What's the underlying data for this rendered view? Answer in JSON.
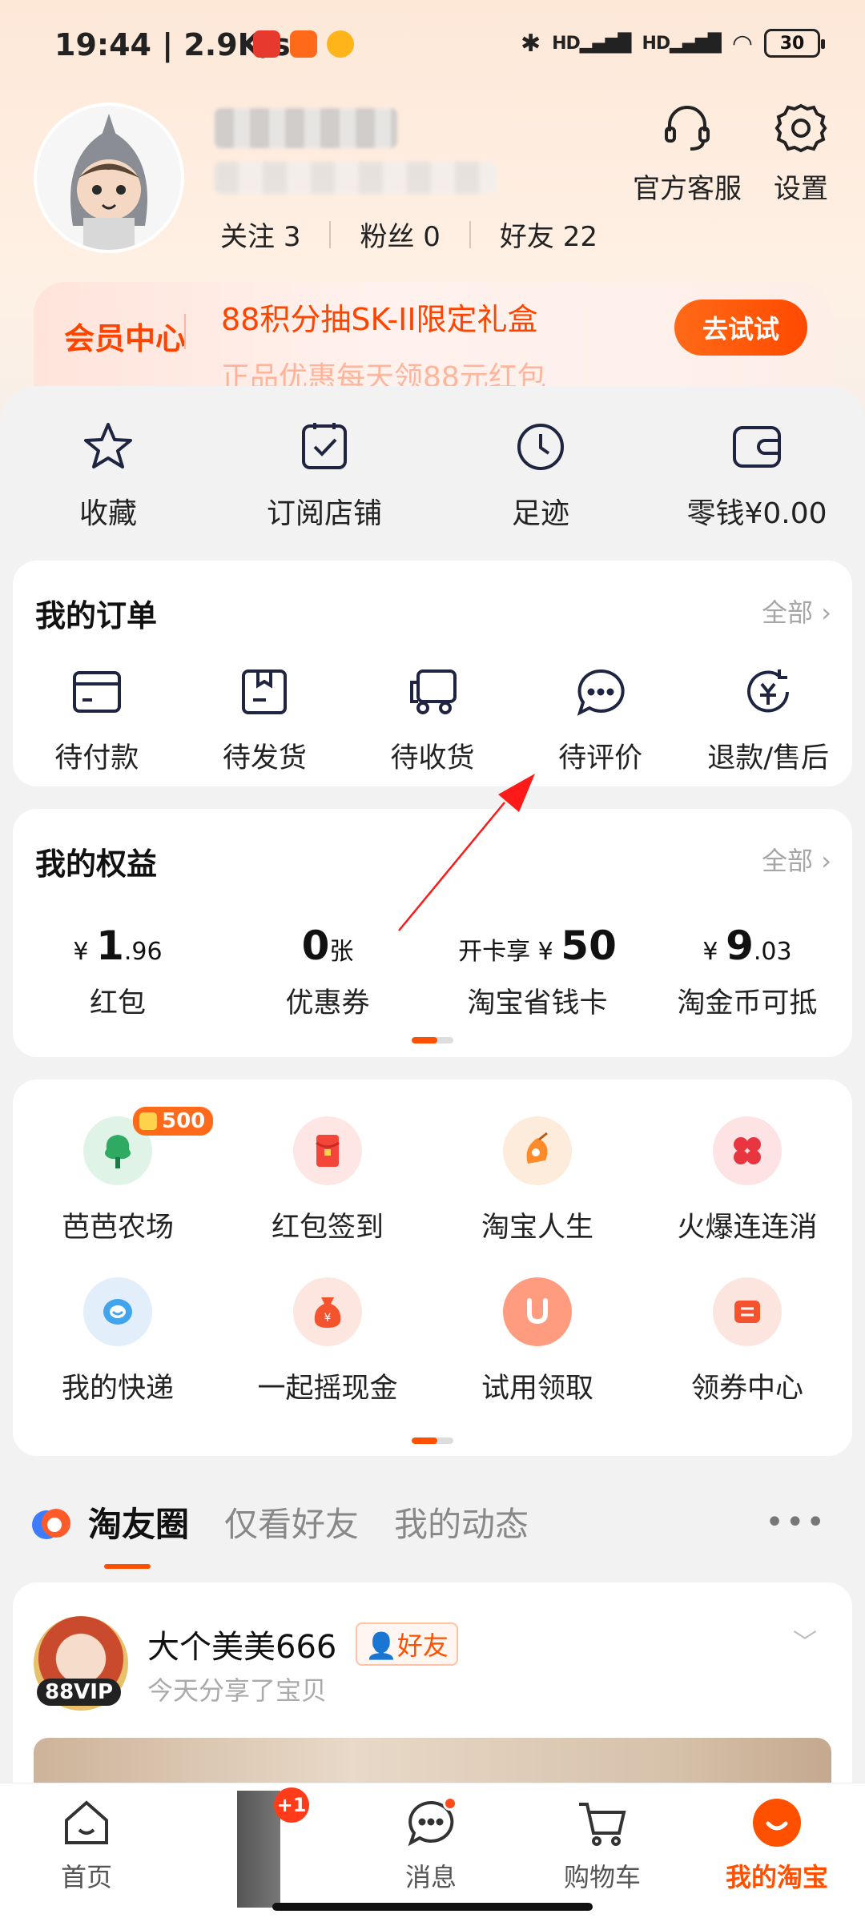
{
  "status_bar": {
    "time": "19:44",
    "speed": "2.9K/s",
    "battery": "30"
  },
  "profile": {
    "follow_label": "关注",
    "follow_count": "3",
    "fans_label": "粉丝",
    "fans_count": "0",
    "friends_label": "好友",
    "friends_count": "22",
    "service_label": "官方客服",
    "settings_label": "设置"
  },
  "member": {
    "title": "会员中心",
    "promo": "88积分抽SK-II限定礼盒",
    "promo2": "正品优惠每天领88元红包",
    "button": "去试试"
  },
  "quick": [
    {
      "label": "收藏",
      "icon": "star-icon"
    },
    {
      "label": "订阅店铺",
      "icon": "subscribe-icon"
    },
    {
      "label": "足迹",
      "icon": "clock-icon"
    },
    {
      "label": "零钱¥0.00",
      "icon": "wallet-icon"
    }
  ],
  "orders": {
    "title": "我的订单",
    "more": "全部",
    "items": [
      {
        "label": "待付款",
        "icon": "card-icon"
      },
      {
        "label": "待发货",
        "icon": "box-icon"
      },
      {
        "label": "待收货",
        "icon": "truck-icon"
      },
      {
        "label": "待评价",
        "icon": "chat-icon"
      },
      {
        "label": "退款/售后",
        "icon": "refund-icon"
      }
    ]
  },
  "equity": {
    "title": "我的权益",
    "more": "全部",
    "items": [
      {
        "prefix": "¥",
        "big": "1",
        "small": ".96",
        "label": "红包"
      },
      {
        "prefix": "",
        "big": "0",
        "small": "张",
        "label": "优惠券"
      },
      {
        "prefix": "开卡享 ¥",
        "big": "50",
        "small": "",
        "label": "淘宝省钱卡"
      },
      {
        "prefix": "¥",
        "big": "9",
        "small": ".03",
        "label": "淘金币可抵"
      }
    ]
  },
  "tools": {
    "badge": "500",
    "items": [
      {
        "label": "芭芭农场",
        "icon": "farm-icon",
        "color": "#dff4e7"
      },
      {
        "label": "红包签到",
        "icon": "redpacket-icon",
        "color": "#fde6e4"
      },
      {
        "label": "淘宝人生",
        "icon": "life-icon",
        "color": "#fdebdc"
      },
      {
        "label": "火爆连连消",
        "icon": "game-icon",
        "color": "#fde3e4"
      },
      {
        "label": "我的快递",
        "icon": "express-icon",
        "color": "#e2effb"
      },
      {
        "label": "一起摇现金",
        "icon": "money-bag-icon",
        "color": "#fde6df"
      },
      {
        "label": "试用领取",
        "icon": "trial-icon",
        "color": "#ffd9d0"
      },
      {
        "label": "领券中心",
        "icon": "coupon-icon",
        "color": "#fde5df"
      }
    ]
  },
  "feed": {
    "tabs": [
      "淘友圈",
      "仅看好友",
      "我的动态"
    ],
    "more": "•••",
    "post": {
      "name": "大个美美666",
      "tag": "好友",
      "vip": "88VIP",
      "subtitle": "今天分享了宝贝"
    }
  },
  "nav": {
    "items": [
      {
        "label": "首页",
        "icon": "home-icon"
      },
      {
        "label": "消息",
        "icon": "message-icon"
      },
      {
        "label": "购物车",
        "icon": "cart-icon"
      },
      {
        "label": "我的淘宝",
        "icon": "my-taobao-icon"
      }
    ],
    "badge": "+1"
  },
  "colors": {
    "accent": "#ff5000",
    "annotation": "#ff1a1a"
  }
}
